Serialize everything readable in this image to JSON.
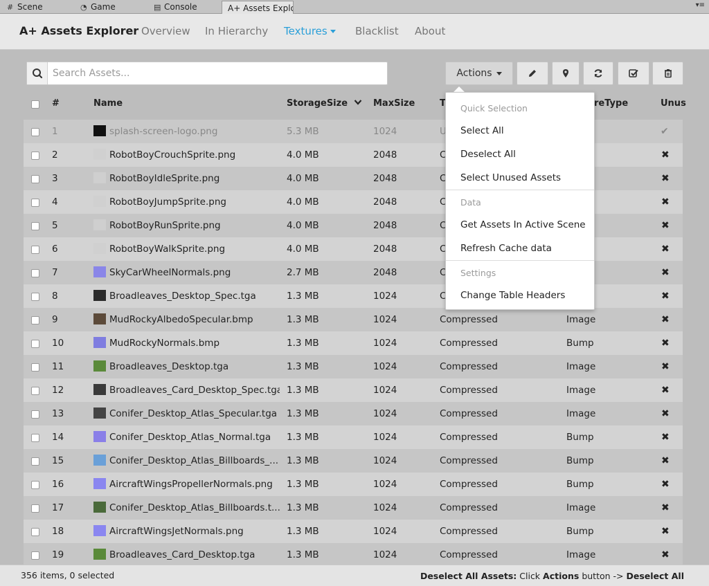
{
  "unity_tabs": [
    {
      "label": "Scene",
      "icon": "grid-icon"
    },
    {
      "label": "Game",
      "icon": "pacman-icon"
    },
    {
      "label": "Console",
      "icon": "console-icon"
    },
    {
      "label": "A+ Assets Explo",
      "icon": ""
    }
  ],
  "header": {
    "brand": "A+ Assets Explorer",
    "nav": [
      "Overview",
      "In Hierarchy",
      "Textures",
      "Blacklist",
      "About"
    ]
  },
  "search": {
    "placeholder": "Search Assets..."
  },
  "toolbar": {
    "actions_label": "Actions"
  },
  "table": {
    "headers": [
      "#",
      "Name",
      "StorageSize",
      "MaxSize",
      "T",
      "reType",
      "Unus"
    ],
    "rows": [
      {
        "num": "1",
        "name": "splash-screen-logo.png",
        "size": "5.3 MB",
        "max": "1024",
        "tex": "U",
        "type": "",
        "unused": "check",
        "thumb": "#111111"
      },
      {
        "num": "2",
        "name": "RobotBoyCrouchSprite.png",
        "size": "4.0 MB",
        "max": "2048",
        "tex": "C",
        "type": "",
        "unused": "x",
        "thumb": "#d0d0d0"
      },
      {
        "num": "3",
        "name": "RobotBoyIdleSprite.png",
        "size": "4.0 MB",
        "max": "2048",
        "tex": "C",
        "type": "",
        "unused": "x",
        "thumb": "#cfcfcf"
      },
      {
        "num": "4",
        "name": "RobotBoyJumpSprite.png",
        "size": "4.0 MB",
        "max": "2048",
        "tex": "C",
        "type": "",
        "unused": "x",
        "thumb": "#d0d0d0"
      },
      {
        "num": "5",
        "name": "RobotBoyRunSprite.png",
        "size": "4.0 MB",
        "max": "2048",
        "tex": "C",
        "type": "",
        "unused": "x",
        "thumb": "#cfcfcf"
      },
      {
        "num": "6",
        "name": "RobotBoyWalkSprite.png",
        "size": "4.0 MB",
        "max": "2048",
        "tex": "C",
        "type": "",
        "unused": "x",
        "thumb": "#d0d0d0"
      },
      {
        "num": "7",
        "name": "SkyCarWheelNormals.png",
        "size": "2.7 MB",
        "max": "2048",
        "tex": "C",
        "type": "",
        "unused": "x",
        "thumb": "#8a86e8"
      },
      {
        "num": "8",
        "name": "Broadleaves_Desktop_Spec.tga",
        "size": "1.3 MB",
        "max": "1024",
        "tex": "C",
        "type": "",
        "unused": "x",
        "thumb": "#2b2b2b"
      },
      {
        "num": "9",
        "name": "MudRockyAlbedoSpecular.bmp",
        "size": "1.3 MB",
        "max": "1024",
        "tex": "Compressed",
        "type": "Image",
        "unused": "x",
        "thumb": "#5c4a3a"
      },
      {
        "num": "10",
        "name": "MudRockyNormals.bmp",
        "size": "1.3 MB",
        "max": "1024",
        "tex": "Compressed",
        "type": "Bump",
        "unused": "x",
        "thumb": "#7f7de0"
      },
      {
        "num": "11",
        "name": "Broadleaves_Desktop.tga",
        "size": "1.3 MB",
        "max": "1024",
        "tex": "Compressed",
        "type": "Image",
        "unused": "x",
        "thumb": "#5a8a3a"
      },
      {
        "num": "12",
        "name": "Broadleaves_Card_Desktop_Spec.tga",
        "size": "1.3 MB",
        "max": "1024",
        "tex": "Compressed",
        "type": "Image",
        "unused": "x",
        "thumb": "#3a3a3a"
      },
      {
        "num": "13",
        "name": "Conifer_Desktop_Atlas_Specular.tga",
        "size": "1.3 MB",
        "max": "1024",
        "tex": "Compressed",
        "type": "Image",
        "unused": "x",
        "thumb": "#444444"
      },
      {
        "num": "14",
        "name": "Conifer_Desktop_Atlas_Normal.tga",
        "size": "1.3 MB",
        "max": "1024",
        "tex": "Compressed",
        "type": "Bump",
        "unused": "x",
        "thumb": "#8a7fe8"
      },
      {
        "num": "15",
        "name": "Conifer_Desktop_Atlas_Billboards_...",
        "size": "1.3 MB",
        "max": "1024",
        "tex": "Compressed",
        "type": "Bump",
        "unused": "x",
        "thumb": "#6aa0d8"
      },
      {
        "num": "16",
        "name": "AircraftWingsPropellerNormals.png",
        "size": "1.3 MB",
        "max": "1024",
        "tex": "Compressed",
        "type": "Bump",
        "unused": "x",
        "thumb": "#8a86f0"
      },
      {
        "num": "17",
        "name": "Conifer_Desktop_Atlas_Billboards.t...",
        "size": "1.3 MB",
        "max": "1024",
        "tex": "Compressed",
        "type": "Image",
        "unused": "x",
        "thumb": "#4a6a3a"
      },
      {
        "num": "18",
        "name": "AircraftWingsJetNormals.png",
        "size": "1.3 MB",
        "max": "1024",
        "tex": "Compressed",
        "type": "Bump",
        "unused": "x",
        "thumb": "#8a86f0"
      },
      {
        "num": "19",
        "name": "Broadleaves_Card_Desktop.tga",
        "size": "1.3 MB",
        "max": "1024",
        "tex": "Compressed",
        "type": "Image",
        "unused": "x",
        "thumb": "#5a8a3a"
      }
    ]
  },
  "dropdown": {
    "quick_header": "Quick Selection",
    "select_all": "Select All",
    "deselect_all": "Deselect All",
    "select_unused": "Select Unused Assets",
    "data_header": "Data",
    "get_assets": "Get Assets In Active Scene",
    "refresh_cache": "Refresh Cache data",
    "settings_header": "Settings",
    "change_headers": "Change Table Headers"
  },
  "footer": {
    "status": "356 items, 0 selected",
    "hint_label": "Deselect All Assets:",
    "hint_click": "Click",
    "hint_actions": "Actions",
    "hint_middle": "button ->",
    "hint_target": "Deselect All"
  },
  "colors": {
    "accent": "#2a9fd8"
  }
}
